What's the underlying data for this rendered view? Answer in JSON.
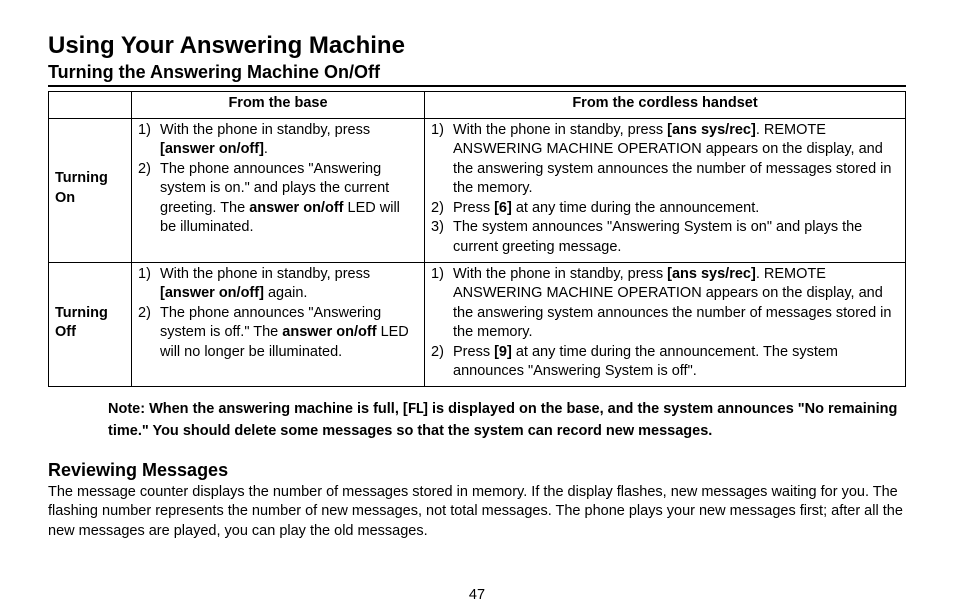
{
  "title": "Using Your Answering Machine",
  "subtitle": "Turning the Answering Machine On/Off",
  "table": {
    "col_base": "From the base",
    "col_handset": "From the cordless handset",
    "row_on_label": "Turning On",
    "row_off_label": "Turning Off",
    "on_base_1_a": "With the phone in standby, press ",
    "on_base_1_b": "[answer on/off]",
    "on_base_1_c": ".",
    "on_base_2_a": "The phone announces \"Answering system is on.\" and plays the current greeting. The ",
    "on_base_2_b": "answer on/off",
    "on_base_2_c": " LED will be illuminated.",
    "on_hs_1_a": "With the phone in standby, press ",
    "on_hs_1_b": "[ans sys/rec]",
    "on_hs_1_c": ". REMOTE ANSWERING MACHINE OPERATION appears on the display, and the answering system announces the number of messages stored in the memory.",
    "on_hs_2_a": "Press ",
    "on_hs_2_b": "[6]",
    "on_hs_2_c": " at any time during the announcement.",
    "on_hs_3": "The system announces \"Answering System is on\" and plays the current greeting message.",
    "off_base_1_a": "With the phone in standby, press ",
    "off_base_1_b": "[answer on/off]",
    "off_base_1_c": " again.",
    "off_base_2_a": "The phone announces \"Answering system is off.\" The ",
    "off_base_2_b": "answer on/off",
    "off_base_2_c": " LED will no longer be illuminated.",
    "off_hs_1_a": "With the phone in standby, press ",
    "off_hs_1_b": "[ans sys/rec]",
    "off_hs_1_c": ". REMOTE ANSWERING MACHINE OPERATION appears on the display, and the answering system announces the number of messages stored in the memory.",
    "off_hs_2_a": "Press ",
    "off_hs_2_b": "[9]",
    "off_hs_2_c": " at any time during the announcement. The system announces \"Answering System is off\"."
  },
  "note": {
    "a": "Note: When the answering machine is full, [",
    "glyph": "FL",
    "b": "] is displayed on the base, and the system announces \"No remaining time.\" You should delete some messages so that the system can record new messages."
  },
  "review": {
    "heading": "Reviewing Messages",
    "body": "The message counter displays the number of messages stored in memory. If the display flashes, new messages waiting for you. The flashing number represents the number of new messages, not total messages. The phone plays your new messages first; after all the new messages are played, you can play the old messages."
  },
  "page_number": "47"
}
